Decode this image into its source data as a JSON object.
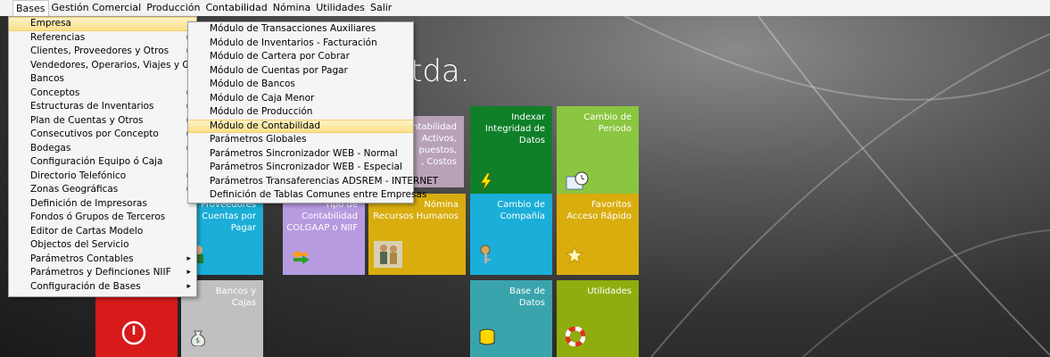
{
  "menubar": {
    "items": [
      "Bases",
      "Gestión Comercial",
      "Producción",
      "Contabilidad",
      "Nómina",
      "Utilidades",
      "Salir"
    ]
  },
  "company_title_suffix": "tda.",
  "bases_menu": {
    "items": [
      "Empresa",
      "Referencias",
      "Clientes, Proveedores y Otros",
      "Vendedores, Operarios, Viajes y Otros",
      "Bancos",
      "Conceptos",
      "Estructuras de Inventarios",
      "Plan de Cuentas y Otros",
      "Consecutivos por Concepto",
      "Bodegas",
      "Configuración  Equipo ó Caja",
      "Directorio Telefónico",
      "Zonas Geográficas",
      "Definición de Impresoras",
      "Fondos ó Grupos de Terceros",
      "Editor de Cartas Modelo",
      "Objectos del Servicio",
      "Parámetros Contables",
      "Parámetros y Definciones NIIF",
      "Configuración de Bases"
    ]
  },
  "empresa_submenu": {
    "items": [
      "Módulo de Transacciones Auxiliares",
      "Módulo de Inventarios - Facturación",
      "Módulo de Cartera por Cobrar",
      "Módulo de Cuentas por Pagar",
      "Módulo de Bancos",
      "Módulo de Caja Menor",
      "Módulo de Producción",
      "Módulo de Contabilidad",
      "Parámetros Globales",
      "Parámetros Sincronizador WEB - Normal",
      "Parámetros Sincronizador WEB - Especial",
      "Parámetros Transaferencias ADSREM - INTERNET",
      "Definición de Tablas Comunes entre Empresas"
    ]
  },
  "tiles": {
    "contabilidad_partial": "ntabilidad\nActivos,\npuestos,\n, Costos",
    "indexar": "Indexar\nIntegridad de\nDatos",
    "cambio_periodo": "Cambio de\nPeriodo",
    "proveedores": "Proveedores\nCuentas por\nPagar",
    "tipo_contabilidad": "Tipo de\nContabilidad\nCOLGAAP o NIIF",
    "nomina": "Nómina\nRecursos Humanos",
    "cambio_compania": "Cambio de\nCompañía",
    "favoritos": "Favoritos\nAcceso Rápido",
    "bancos_cajas": "Bancos y\nCajas",
    "base_datos": "Base de\nDatos",
    "utilidades": "Utilidades"
  },
  "colors": {
    "dark_green": "#0f7f2a",
    "light_green": "#8ac63f",
    "cyan": "#1aaed8",
    "lavender": "#b79be0",
    "gold": "#d9ad0e",
    "teal": "#3aa4ad",
    "olive": "#8fad0e",
    "red": "#d71a1a",
    "gray": "#c0c0c0",
    "mauve": "#b8a2b8"
  }
}
